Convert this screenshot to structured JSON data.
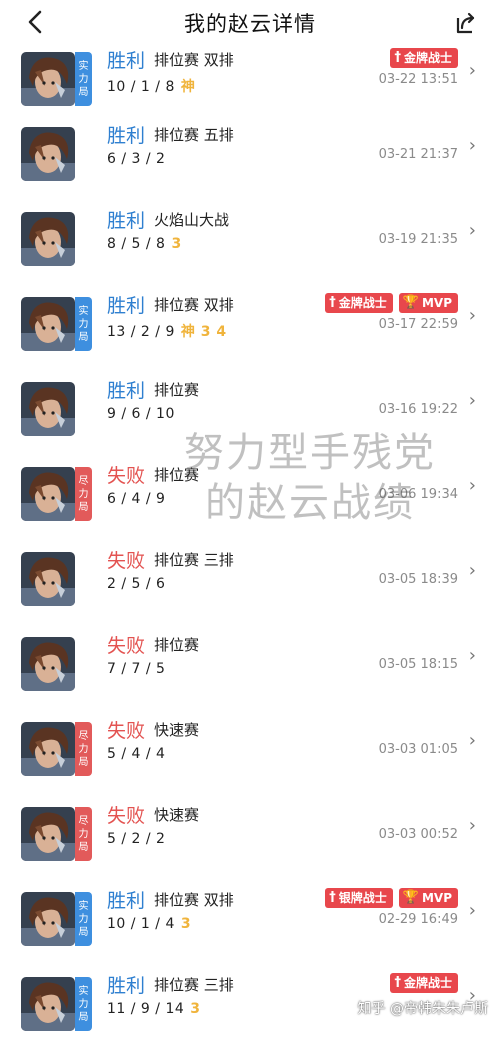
{
  "header": {
    "title": "我的赵云详情"
  },
  "colors": {
    "win": "#2e7fd0",
    "loss": "#e35351",
    "tag_strength": "#3e8fdf",
    "tag_effort": "#e25a5a",
    "badge": "#e8474c",
    "highlight": "#f0b43c"
  },
  "matches": [
    {
      "result": "胜利",
      "outcome": "win",
      "mode": "排位赛 双排",
      "kda": "10 / 1 / 8",
      "highlight": "神",
      "tag": [
        "实",
        "力",
        "局"
      ],
      "tag_type": "strength",
      "badges": [
        "金牌战士"
      ],
      "date": "03-22 13:51"
    },
    {
      "result": "胜利",
      "outcome": "win",
      "mode": "排位赛 五排",
      "kda": "6 / 3 / 2",
      "highlight": "",
      "tag": [],
      "tag_type": "",
      "badges": [],
      "date": "03-21 21:37"
    },
    {
      "result": "胜利",
      "outcome": "win",
      "mode": "火焰山大战",
      "kda": "8 / 5 / 8",
      "highlight": "3",
      "tag": [],
      "tag_type": "",
      "badges": [],
      "date": "03-19 21:35"
    },
    {
      "result": "胜利",
      "outcome": "win",
      "mode": "排位赛 双排",
      "kda": "13 / 2 / 9",
      "highlight": "神 3 4",
      "tag": [
        "实",
        "力",
        "局"
      ],
      "tag_type": "strength",
      "badges": [
        "金牌战士",
        "MVP"
      ],
      "date": "03-17 22:59"
    },
    {
      "result": "胜利",
      "outcome": "win",
      "mode": "排位赛",
      "kda": "9 / 6 / 10",
      "highlight": "",
      "tag": [],
      "tag_type": "",
      "badges": [],
      "date": "03-16 19:22"
    },
    {
      "result": "失败",
      "outcome": "loss",
      "mode": "排位赛",
      "kda": "6 / 4 / 9",
      "highlight": "",
      "tag": [
        "尽",
        "力",
        "局"
      ],
      "tag_type": "effort",
      "badges": [],
      "date": "03-06 19:34"
    },
    {
      "result": "失败",
      "outcome": "loss",
      "mode": "排位赛 三排",
      "kda": "2 / 5 / 6",
      "highlight": "",
      "tag": [],
      "tag_type": "",
      "badges": [],
      "date": "03-05 18:39"
    },
    {
      "result": "失败",
      "outcome": "loss",
      "mode": "排位赛",
      "kda": "7 / 7 / 5",
      "highlight": "",
      "tag": [],
      "tag_type": "",
      "badges": [],
      "date": "03-05 18:15"
    },
    {
      "result": "失败",
      "outcome": "loss",
      "mode": "快速赛",
      "kda": "5 / 4 / 4",
      "highlight": "",
      "tag": [
        "尽",
        "力",
        "局"
      ],
      "tag_type": "effort",
      "badges": [],
      "date": "03-03 01:05"
    },
    {
      "result": "失败",
      "outcome": "loss",
      "mode": "快速赛",
      "kda": "5 / 2 / 2",
      "highlight": "",
      "tag": [
        "尽",
        "力",
        "局"
      ],
      "tag_type": "effort",
      "badges": [],
      "date": "03-03 00:52"
    },
    {
      "result": "胜利",
      "outcome": "win",
      "mode": "排位赛 双排",
      "kda": "10 / 1 / 4",
      "highlight": "3",
      "tag": [
        "实",
        "力",
        "局"
      ],
      "tag_type": "strength",
      "badges": [
        "银牌战士",
        "MVP"
      ],
      "date": "02-29 16:49"
    },
    {
      "result": "胜利",
      "outcome": "win",
      "mode": "排位赛 三排",
      "kda": "11 / 9 / 14",
      "highlight": "3",
      "tag": [
        "实",
        "力",
        "局"
      ],
      "tag_type": "strength",
      "badges": [
        "金牌战士"
      ],
      "date": ""
    }
  ],
  "watermark": [
    "努力型手残党",
    "的赵云战绩"
  ],
  "credit": "知乎 @帝韩朱朱卢斯"
}
